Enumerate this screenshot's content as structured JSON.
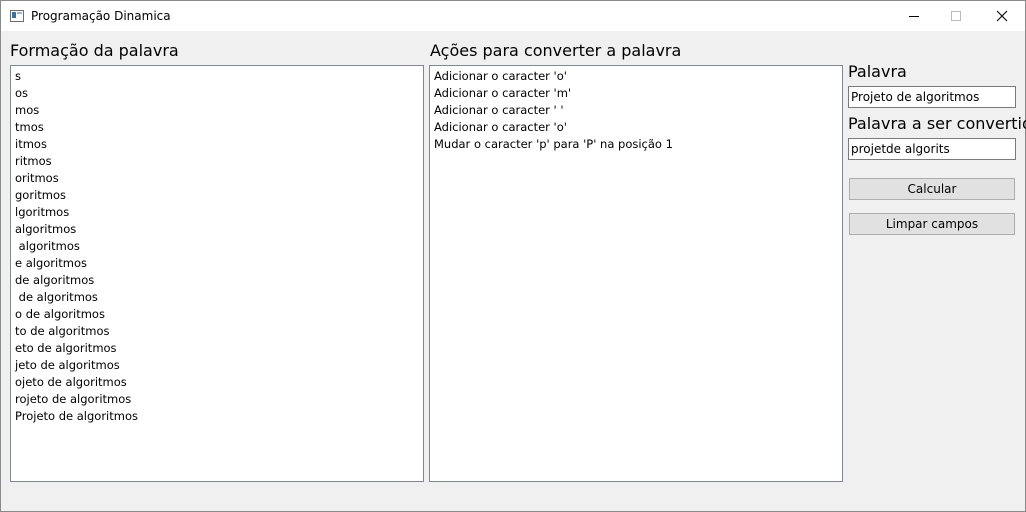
{
  "window": {
    "title": "Programação Dinamica",
    "icon": "application-window-icon",
    "controls": [
      "minimize-icon",
      "maximize-icon",
      "close-icon"
    ]
  },
  "formation": {
    "label": "Formação da palavra",
    "items": [
      "s",
      "os",
      "mos",
      "tmos",
      "itmos",
      "ritmos",
      "oritmos",
      "goritmos",
      "lgoritmos",
      "algoritmos",
      " algoritmos",
      "e algoritmos",
      "de algoritmos",
      " de algoritmos",
      "o de algoritmos",
      "to de algoritmos",
      "eto de algoritmos",
      "jeto de algoritmos",
      "ojeto de algoritmos",
      "rojeto de algoritmos",
      "Projeto de algoritmos"
    ]
  },
  "actions": {
    "label": "Ações para converter a palavra",
    "items": [
      "Adicionar o caracter 'o'",
      "Adicionar o caracter 'm'",
      "Adicionar o caracter ' '",
      "Adicionar o caracter 'o'",
      "Mudar o caracter 'p' para 'P' na posição 1"
    ]
  },
  "form": {
    "word_label": "Palavra",
    "word_value": "Projeto de algoritmos",
    "target_label": "Palavra a ser convertida",
    "target_value": "projetde algorits",
    "calculate_label": "Calcular",
    "clear_label": "Limpar campos"
  }
}
